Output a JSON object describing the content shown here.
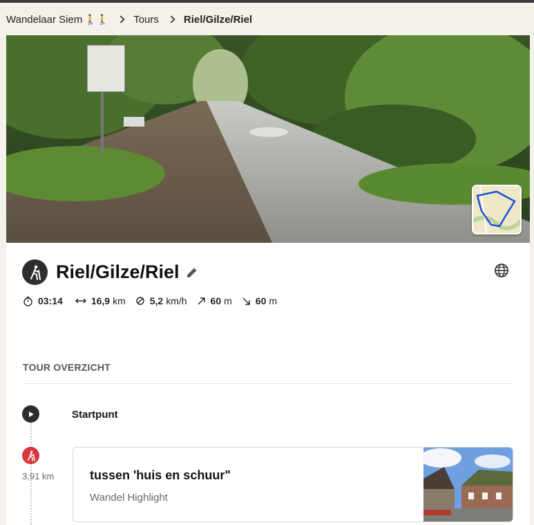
{
  "breadcrumb": {
    "user": "Wandelaar Siem",
    "user_emoji": "🚶🚶",
    "tours": "Tours",
    "current": "Riel/Gilze/Riel"
  },
  "tour": {
    "title": "Riel/Gilze/Riel",
    "sport_icon": "hiking-icon",
    "stats": {
      "duration": "03:14",
      "distance_value": "16,9",
      "distance_unit": "km",
      "speed_value": "5,2",
      "speed_unit": "km/h",
      "ascent_value": "60",
      "ascent_unit": "m",
      "descent_value": "60",
      "descent_unit": "m"
    }
  },
  "overview": {
    "title": "TOUR OVERZICHT",
    "start_label": "Startpunt",
    "highlight": {
      "distance": "3,91 km",
      "name": "tussen 'huis en schuur\"",
      "type": "Wandel Highlight"
    }
  },
  "colors": {
    "accent_red": "#d9363e",
    "dark": "#2d2d2d",
    "route_blue": "#1d4fd8"
  }
}
